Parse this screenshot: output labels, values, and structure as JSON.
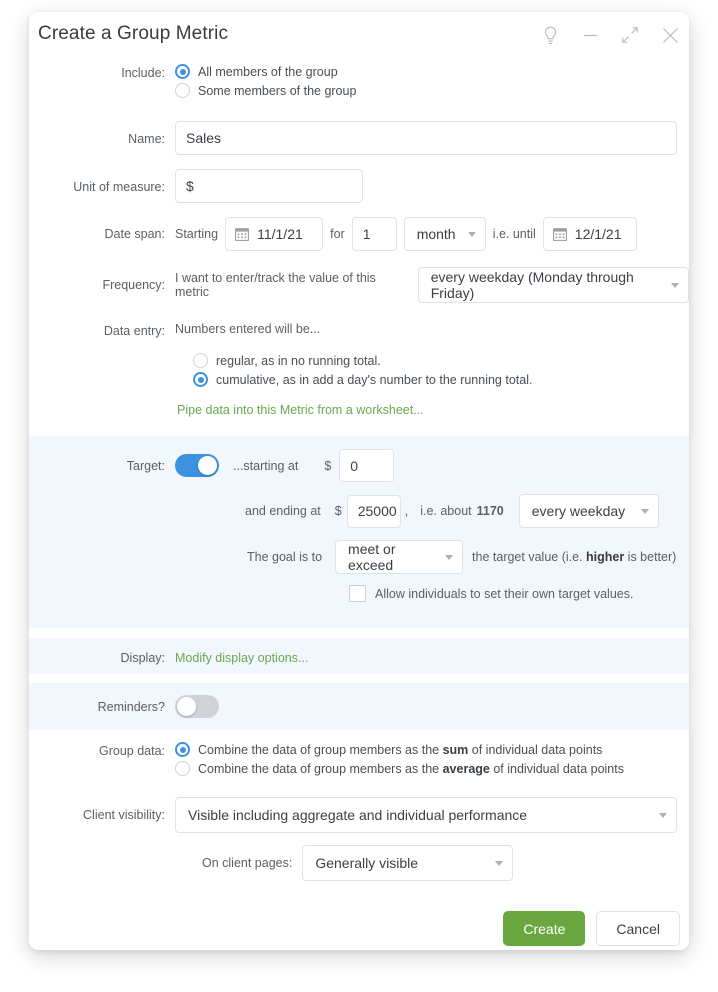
{
  "window": {
    "title": "Create a Group Metric",
    "controls": [
      {
        "name": "help-lightbulb-icon",
        "label": "Help"
      },
      {
        "name": "minimize-icon",
        "label": "Minimize"
      },
      {
        "name": "expand-icon",
        "label": "Expand"
      },
      {
        "name": "close-icon",
        "label": "Close"
      }
    ]
  },
  "include": {
    "label": "Include:",
    "options": [
      {
        "label": "All members of the group",
        "selected": true
      },
      {
        "label": "Some members of the group",
        "selected": false
      }
    ]
  },
  "name": {
    "label": "Name:",
    "value": "Sales",
    "placeholder": ""
  },
  "unit": {
    "label": "Unit of measure:",
    "value": "$",
    "placeholder": ""
  },
  "date_span": {
    "label": "Date span:",
    "starting_text": "Starting",
    "start_date": "11/1/21",
    "for_text": "for",
    "duration_value": "1",
    "duration_unit": "month",
    "until_text": "i.e. until",
    "end_date": "12/1/21"
  },
  "frequency": {
    "label": "Frequency:",
    "prefix": "I want to enter/track the value of this metric",
    "value": "every weekday (Monday through Friday)"
  },
  "data_entry": {
    "label": "Data entry:",
    "intro": "Numbers entered will be...",
    "options": [
      {
        "label": "regular, as in no running total.",
        "selected": false
      },
      {
        "label": "cumulative, as in add a day's number to the running total.",
        "selected": true
      }
    ],
    "pipe_link": "Pipe data into this Metric from a worksheet..."
  },
  "target": {
    "label": "Target:",
    "enabled": true,
    "starting_text": "...starting at",
    "currency": "$",
    "start_value": "0",
    "ending_text": "and ending at",
    "end_currency": "$",
    "end_value": "25000",
    "comma": ",",
    "about_prefix": "i.e. about",
    "about_value": "1170",
    "rate_unit": "every weekday",
    "goal_prefix": "The goal is to",
    "goal_value": "meet or exceed",
    "goal_suffix_1": "the target value (i.e. ",
    "goal_suffix_bold": "higher",
    "goal_suffix_2": " is better)",
    "allow_individual_label": "Allow individuals to set their own target values.",
    "allow_individual_checked": false
  },
  "display": {
    "label": "Display:",
    "link": "Modify display options..."
  },
  "reminders": {
    "label": "Reminders?",
    "enabled": false
  },
  "group_data": {
    "label": "Group data:",
    "options": [
      {
        "pre": "Combine the data of group members as the ",
        "bold": "sum",
        "post": " of individual data points",
        "selected": true
      },
      {
        "pre": "Combine the data of group members as the ",
        "bold": "average",
        "post": " of individual data points",
        "selected": false
      }
    ]
  },
  "client_visibility": {
    "label": "Client visibility:",
    "value": "Visible including aggregate and individual performance"
  },
  "client_pages": {
    "label": "On client pages:",
    "value": "Generally visible"
  },
  "actions": {
    "create_label": "Create",
    "cancel_label": "Cancel"
  },
  "colors": {
    "accent_blue": "#3b92e0",
    "accent_green": "#6aa84f",
    "band_blue": "#f2f6fd",
    "button_green": "#6aa83f"
  }
}
